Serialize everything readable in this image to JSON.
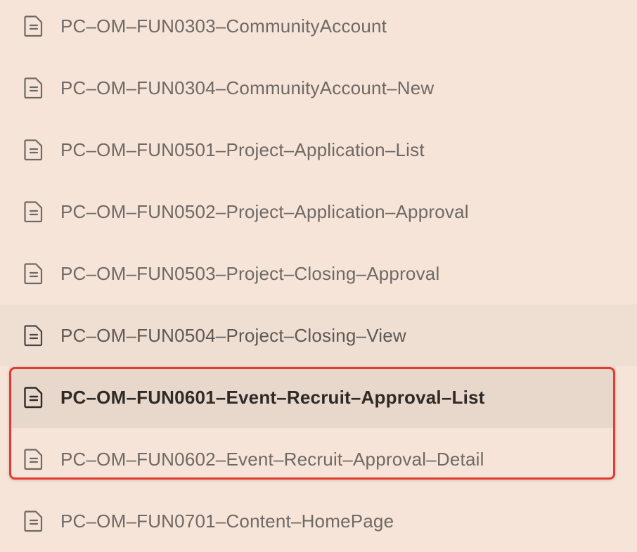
{
  "colors": {
    "background": "#f6e4d8",
    "active_row": "#e8d8cc",
    "hover_row": "#efdfd3",
    "text": "#6f6965",
    "active_text": "#2f2a27",
    "highlight_border": "#e53b2e"
  },
  "pages": [
    {
      "label": "PC–OM–FUN0303–CommunityAccount",
      "icon": "document-icon"
    },
    {
      "label": "PC–OM–FUN0304–CommunityAccount–New",
      "icon": "document-icon"
    },
    {
      "label": "PC–OM–FUN0501–Project–Application–List",
      "icon": "document-icon"
    },
    {
      "label": "PC–OM–FUN0502–Project–Application–Approval",
      "icon": "document-icon"
    },
    {
      "label": "PC–OM–FUN0503–Project–Closing–Approval",
      "icon": "document-icon"
    },
    {
      "label": "PC–OM–FUN0504–Project–Closing–View",
      "icon": "document-icon",
      "state": "hover"
    },
    {
      "label": "PC–OM–FUN0601–Event–Recruit–Approval–List",
      "icon": "document-icon",
      "state": "active"
    },
    {
      "label": "PC–OM–FUN0602–Event–Recruit–Approval–Detail",
      "icon": "document-icon"
    },
    {
      "label": "PC–OM–FUN0701–Content–HomePage",
      "icon": "document-icon"
    }
  ]
}
